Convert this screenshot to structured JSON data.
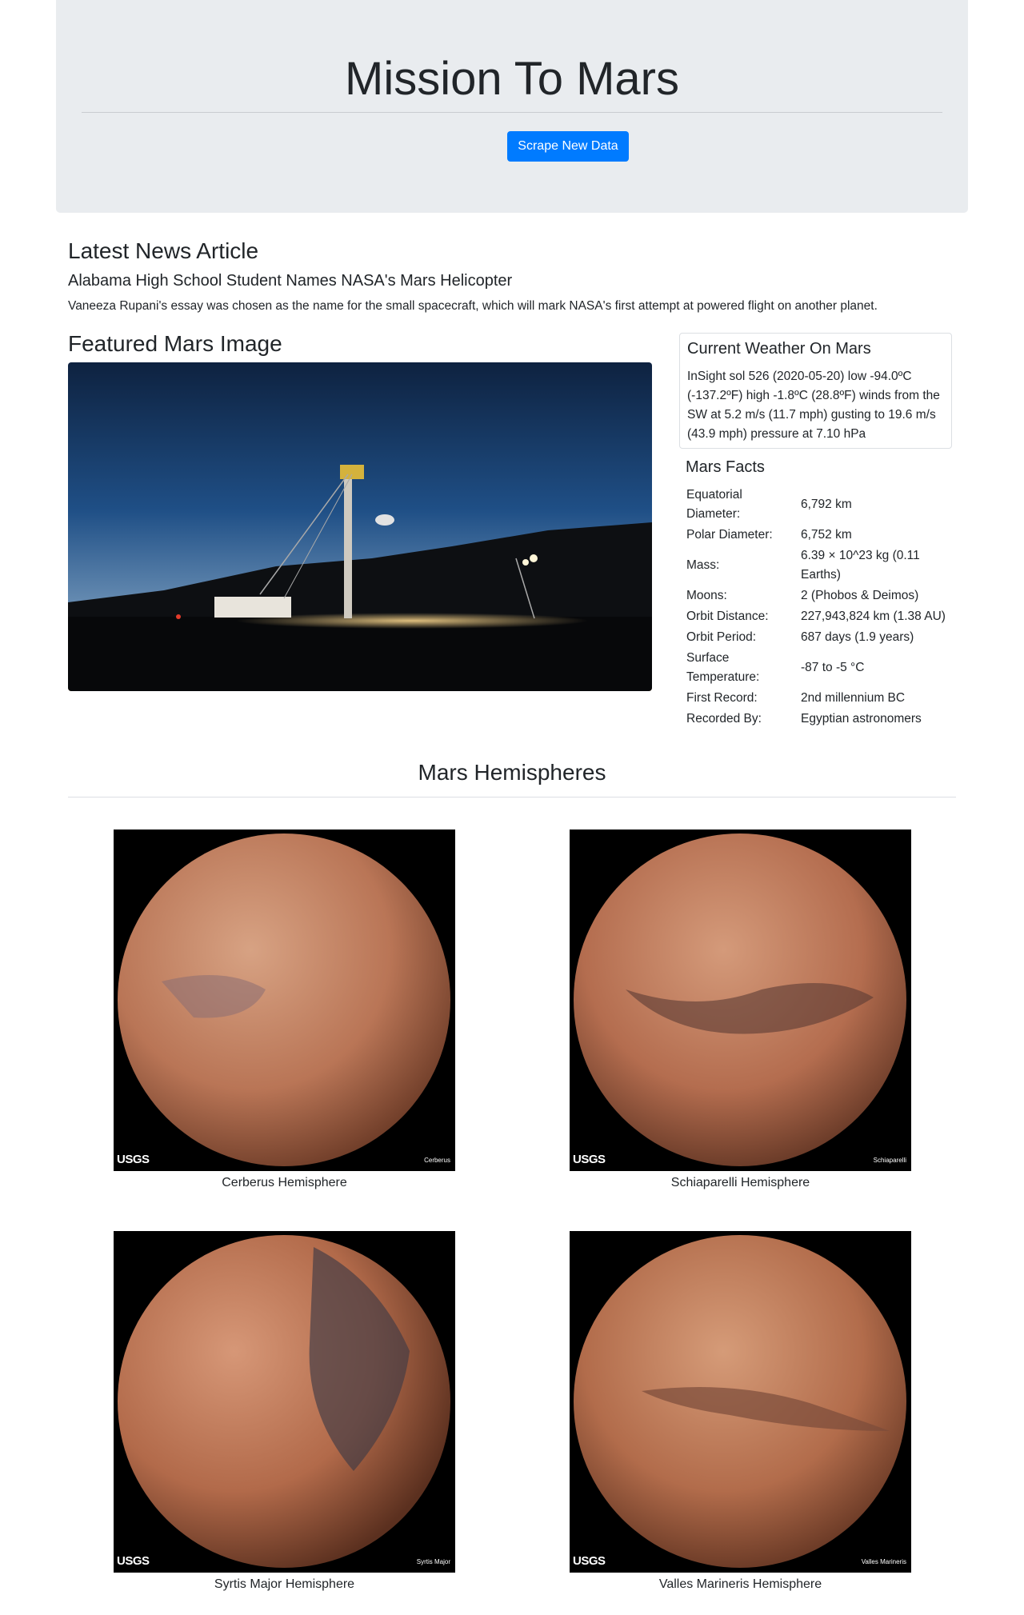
{
  "header": {
    "title": "Mission To Mars",
    "scrape_button": "Scrape New Data"
  },
  "news": {
    "heading": "Latest News Article",
    "title": "Alabama High School Student Names NASA's Mars Helicopter",
    "teaser": "Vaneeza Rupani's essay was chosen as the name for the small spacecraft, which will mark NASA's first attempt at powered flight on another planet."
  },
  "featured": {
    "heading": "Featured Mars Image"
  },
  "weather": {
    "title": "Current Weather On Mars",
    "text": "InSight sol 526 (2020-05-20) low -94.0ºC (-137.2ºF) high -1.8ºC (28.8ºF) winds from the SW at 5.2 m/s (11.7 mph) gusting to 19.6 m/s (43.9 mph) pressure at 7.10 hPa"
  },
  "facts": {
    "title": "Mars Facts",
    "rows": [
      {
        "label": "Equatorial Diameter:",
        "value": "6,792 km"
      },
      {
        "label": "Polar Diameter:",
        "value": "6,752 km"
      },
      {
        "label": "Mass:",
        "value": "6.39 × 10^23 kg (0.11 Earths)"
      },
      {
        "label": "Moons:",
        "value": "2 (Phobos & Deimos)"
      },
      {
        "label": "Orbit Distance:",
        "value": "227,943,824 km (1.38 AU)"
      },
      {
        "label": "Orbit Period:",
        "value": "687 days (1.9 years)"
      },
      {
        "label": "Surface Temperature:",
        "value": "-87 to -5 °C"
      },
      {
        "label": "First Record:",
        "value": "2nd millennium BC"
      },
      {
        "label": "Recorded By:",
        "value": "Egyptian astronomers"
      }
    ]
  },
  "hemispheres": {
    "heading": "Mars Hemispheres",
    "items": [
      {
        "title": "Cerberus Hemisphere",
        "overlay": "Cerberus"
      },
      {
        "title": "Schiaparelli Hemisphere",
        "overlay": "Schiaparelli"
      },
      {
        "title": "Syrtis Major Hemisphere",
        "overlay": "Syrtis Major"
      },
      {
        "title": "Valles Marineris Hemisphere",
        "overlay": "Valles Marineris"
      }
    ],
    "logo_text": "USGS"
  }
}
